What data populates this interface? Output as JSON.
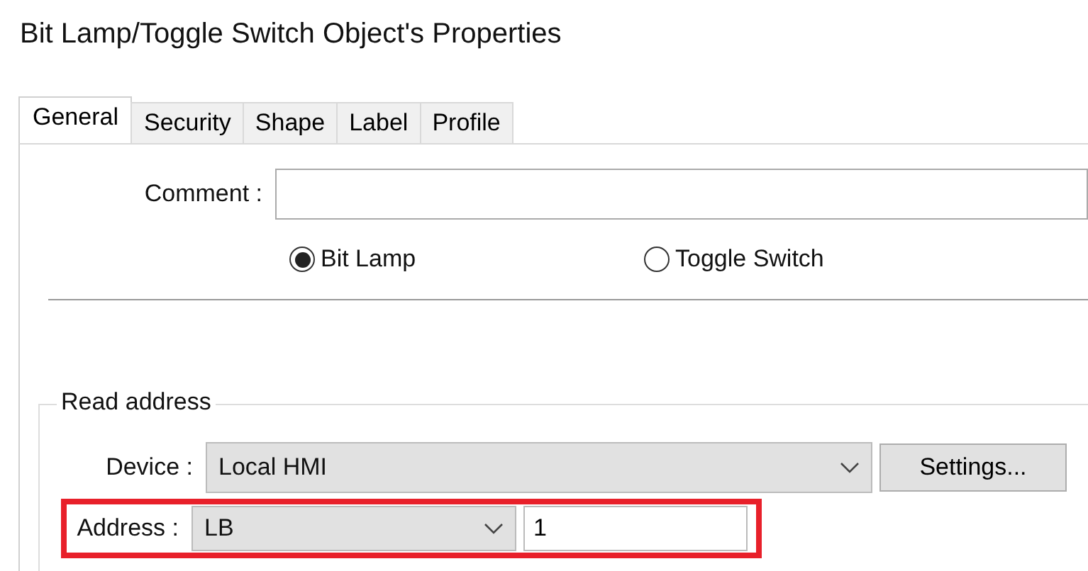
{
  "window": {
    "title": "Bit Lamp/Toggle Switch Object's Properties"
  },
  "tabs": [
    {
      "label": "General",
      "selected": true
    },
    {
      "label": "Security",
      "selected": false
    },
    {
      "label": "Shape",
      "selected": false
    },
    {
      "label": "Label",
      "selected": false
    },
    {
      "label": "Profile",
      "selected": false
    }
  ],
  "comment": {
    "label": "Comment :"
  },
  "mode_options": [
    {
      "label": "Bit Lamp",
      "selected": true
    },
    {
      "label": "Toggle Switch",
      "selected": false
    }
  ],
  "read_address": {
    "title": "Read address",
    "device": {
      "label": "Device :",
      "value": "Local HMI",
      "button": "Settings..."
    },
    "address": {
      "label": "Address :",
      "type": "LB",
      "value": "1",
      "highlighted": true
    }
  }
}
